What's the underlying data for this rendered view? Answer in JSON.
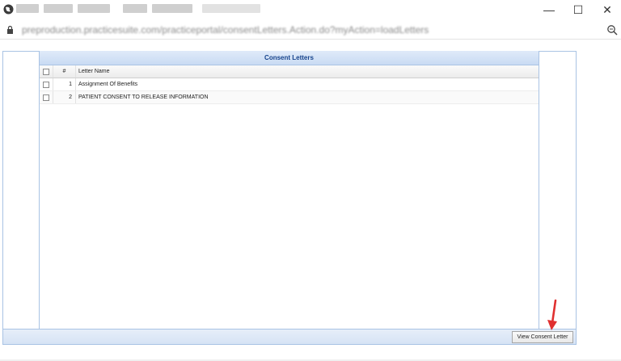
{
  "window": {
    "minimize_label": "—",
    "maximize_label": "☐",
    "close_label": "✕"
  },
  "address_bar": {
    "url": "preproduction.practicesuite.com/practiceportal/consentLetters.Action.do?myAction=loadLetters"
  },
  "icons": {
    "globe": "globe-icon",
    "lock": "lock-icon",
    "zoom": "zoom-icon",
    "arrow": "red-arrow-annotation"
  },
  "colors": {
    "panel_border": "#a9c3e4",
    "title_text": "#15428b",
    "arrow": "#e03030"
  },
  "grid": {
    "title": "Consent Letters",
    "columns": {
      "number": "#",
      "name": "Letter Name"
    },
    "rows": [
      {
        "number": "1",
        "name": "Assignment Of Benefits"
      },
      {
        "number": "2",
        "name": "PATIENT CONSENT TO RELEASE INFORMATION"
      }
    ]
  },
  "actions": {
    "view_consent_letter": "View Consent Letter"
  }
}
